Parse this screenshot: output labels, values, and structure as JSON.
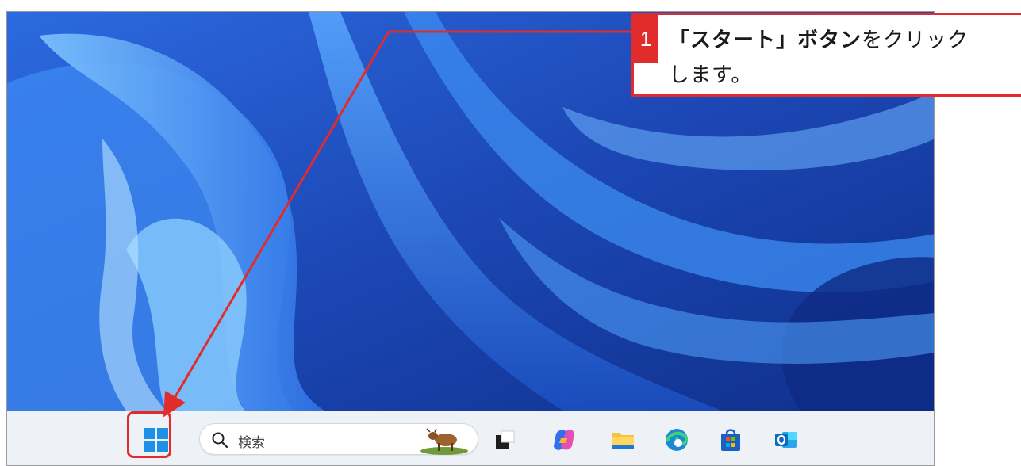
{
  "callout": {
    "step_number": "1",
    "bold_text": "「スタート」ボタン",
    "normal_text": "をクリック",
    "line2": "します。"
  },
  "taskbar": {
    "search_placeholder": "検索",
    "buttons": [
      {
        "name": "start",
        "icon": "windows-logo-icon"
      },
      {
        "name": "task-view",
        "icon": "task-view-icon"
      },
      {
        "name": "copilot",
        "icon": "copilot-icon"
      },
      {
        "name": "file-explorer",
        "icon": "folder-icon"
      },
      {
        "name": "edge",
        "icon": "edge-icon"
      },
      {
        "name": "store",
        "icon": "store-icon"
      },
      {
        "name": "outlook",
        "icon": "outlook-icon"
      }
    ]
  },
  "colors": {
    "accent_red": "#e22b2b",
    "wallpaper_blue": "#1f4fb8",
    "taskbar_bg": "#eef1f5"
  }
}
